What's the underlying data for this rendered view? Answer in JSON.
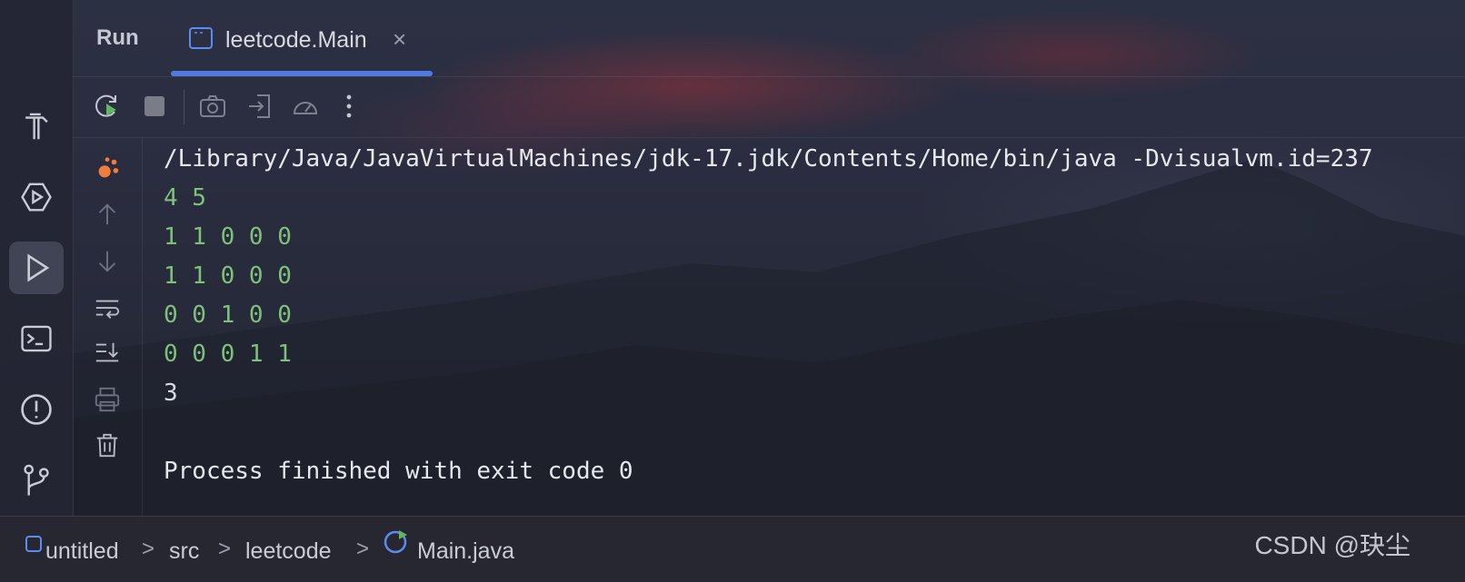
{
  "header": {
    "panel_title": "Run",
    "tab_label": "leetcode.Main",
    "tab_close": "×"
  },
  "left_strip": {
    "items": [
      {
        "icon": "hammer-icon"
      },
      {
        "icon": "services-icon"
      },
      {
        "icon": "run-icon",
        "active": true
      },
      {
        "icon": "terminal-icon"
      },
      {
        "icon": "problems-icon"
      },
      {
        "icon": "git-icon"
      }
    ]
  },
  "toolbar": {
    "items": [
      "rerun-icon",
      "stop-icon",
      "screenshot-icon",
      "attach-icon",
      "profiler-icon",
      "more-icon"
    ]
  },
  "console": {
    "lines": [
      {
        "text": "/Library/Java/JavaVirtualMachines/jdk-17.jdk/Contents/Home/bin/java -Dvisualvm.id=237",
        "kind": "cmd"
      },
      {
        "text": "4 5",
        "kind": "in"
      },
      {
        "text": "1 1 0 0 0",
        "kind": "in"
      },
      {
        "text": "1 1 0 0 0",
        "kind": "in"
      },
      {
        "text": "0 0 1 0 0",
        "kind": "in"
      },
      {
        "text": "0 0 0 1 1",
        "kind": "in"
      },
      {
        "text": "3",
        "kind": "out"
      },
      {
        "text": "",
        "kind": "out"
      },
      {
        "text": "Process finished with exit code 0",
        "kind": "done"
      }
    ]
  },
  "breadcrumb": {
    "items": [
      "untitled",
      "src",
      "leetcode",
      "Main.java"
    ],
    "separator": ">"
  },
  "watermark": "CSDN @玦尘",
  "colors": {
    "accent": "#4f7ae0",
    "input_green": "#7ec27a",
    "debug_orange": "#ef7d3b"
  }
}
